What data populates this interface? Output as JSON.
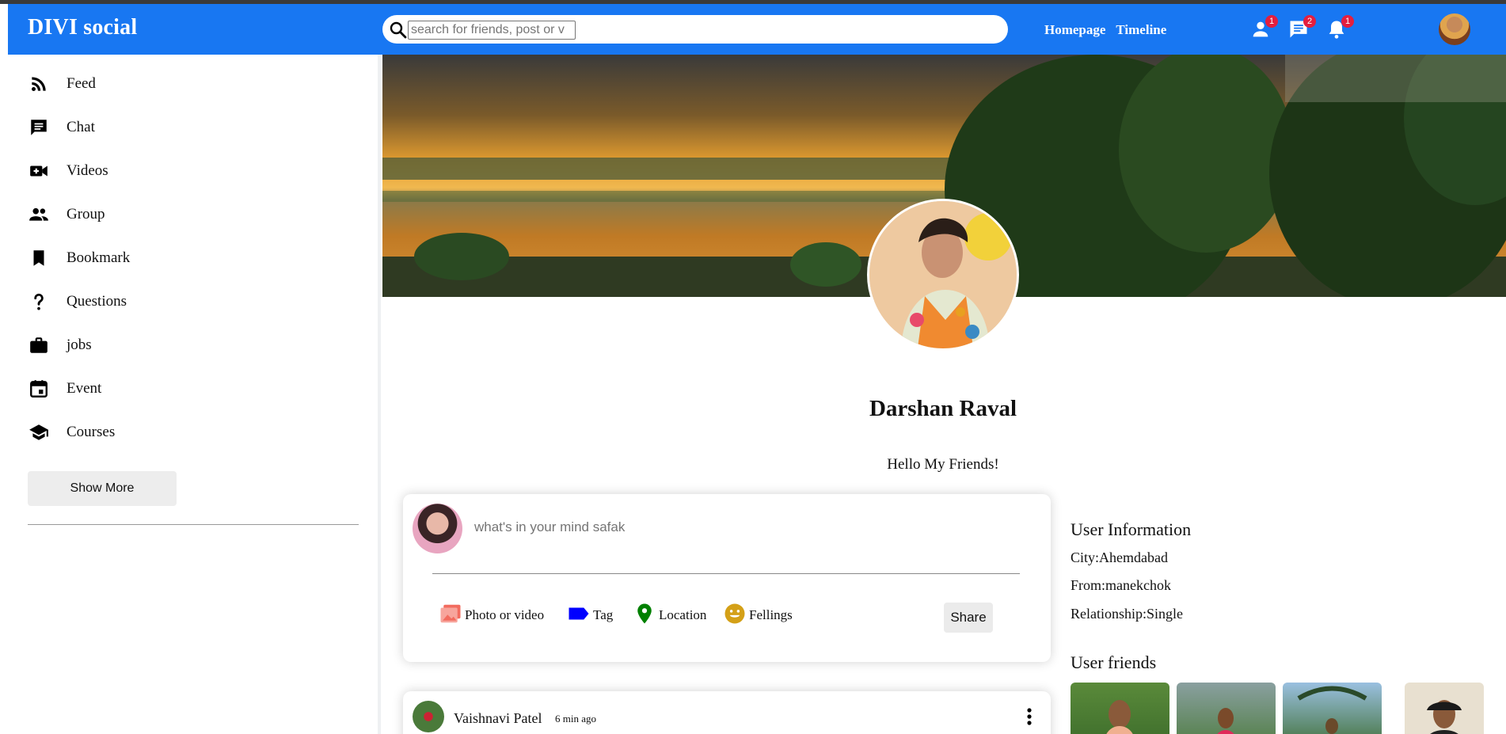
{
  "navbar": {
    "logo": "DIVI social",
    "search_placeholder": "search for friends, post or v",
    "links": [
      "Homepage",
      "Timeline"
    ],
    "badges": {
      "friends": "1",
      "messages": "2",
      "notifications": "1"
    }
  },
  "sidebar": {
    "items": [
      {
        "label": "Feed",
        "icon": "rss-feed-icon"
      },
      {
        "label": "Chat",
        "icon": "chat-icon"
      },
      {
        "label": "Videos",
        "icon": "video-camera-icon"
      },
      {
        "label": "Group",
        "icon": "group-icon"
      },
      {
        "label": "Bookmark",
        "icon": "bookmark-icon"
      },
      {
        "label": "Questions",
        "icon": "question-mark-icon"
      },
      {
        "label": "jobs",
        "icon": "briefcase-icon"
      },
      {
        "label": "Event",
        "icon": "calendar-event-icon"
      },
      {
        "label": "Courses",
        "icon": "graduation-cap-icon"
      }
    ],
    "show_more": "Show More"
  },
  "profile": {
    "name": "Darshan Raval",
    "bio": "Hello My Friends!"
  },
  "share": {
    "placeholder": "what's in your mind safak",
    "options": [
      {
        "label": "Photo or video",
        "icon": "photo-icon",
        "color": "#f26c5f"
      },
      {
        "label": "Tag",
        "icon": "tag-icon",
        "color": "#0000ff"
      },
      {
        "label": "Location",
        "icon": "location-pin-icon",
        "color": "#008000"
      },
      {
        "label": "Fellings",
        "icon": "smiley-icon",
        "color": "#d4a017"
      }
    ],
    "share_button": "Share"
  },
  "post": {
    "author": "Vaishnavi Patel",
    "time": "6 min ago"
  },
  "user_info": {
    "title": "User Information",
    "city": "City:Ahemdabad",
    "from": "From:manekchok",
    "relationship": "Relationship:Single"
  },
  "user_friends": {
    "title": "User friends"
  },
  "colors": {
    "navbar": "#1877f2",
    "badge": "#e41e3f"
  }
}
